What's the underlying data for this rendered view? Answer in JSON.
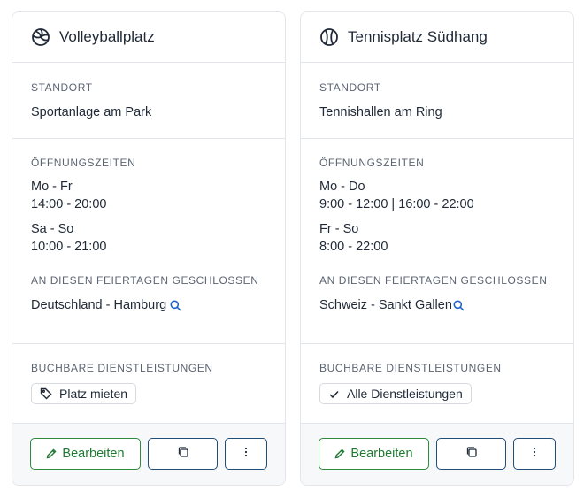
{
  "labels": {
    "location": "STANDORT",
    "opening_hours": "ÖFFNUNGSZEITEN",
    "holidays_closed": "AN DIESEN FEIERTAGEN GESCHLOSSEN",
    "bookable_services": "BUCHBARE DIENSTLEISTUNGEN",
    "edit": "Bearbeiten"
  },
  "cards": [
    {
      "title": "Volleyballplatz",
      "icon": "volleyball-icon",
      "location": "Sportanlage am Park",
      "hours": [
        {
          "days": "Mo - Fr",
          "times": "14:00 - 20:00"
        },
        {
          "days": "Sa - So",
          "times": "10:00 - 21:00"
        }
      ],
      "holidays": "Deutschland - Hamburg",
      "service": {
        "label": "Platz mieten",
        "icon": "tag-icon"
      }
    },
    {
      "title": "Tennisplatz Südhang",
      "icon": "tennis-ball-icon",
      "location": "Tennishallen am Ring",
      "hours": [
        {
          "days": "Mo - Do",
          "times": "9:00 - 12:00 | 16:00 - 22:00"
        },
        {
          "days": "Fr - So",
          "times": "8:00 - 22:00"
        }
      ],
      "holidays": "Schweiz - Sankt Gallen",
      "service": {
        "label": "Alle Dienstleistungen",
        "icon": "check-icon"
      }
    }
  ],
  "colors": {
    "accent_green": "#1e7a31",
    "accent_blue": "#1f4e79",
    "link_blue": "#1d63c9",
    "border": "#e2e5ea",
    "footer_bg": "#f6f8fa"
  }
}
